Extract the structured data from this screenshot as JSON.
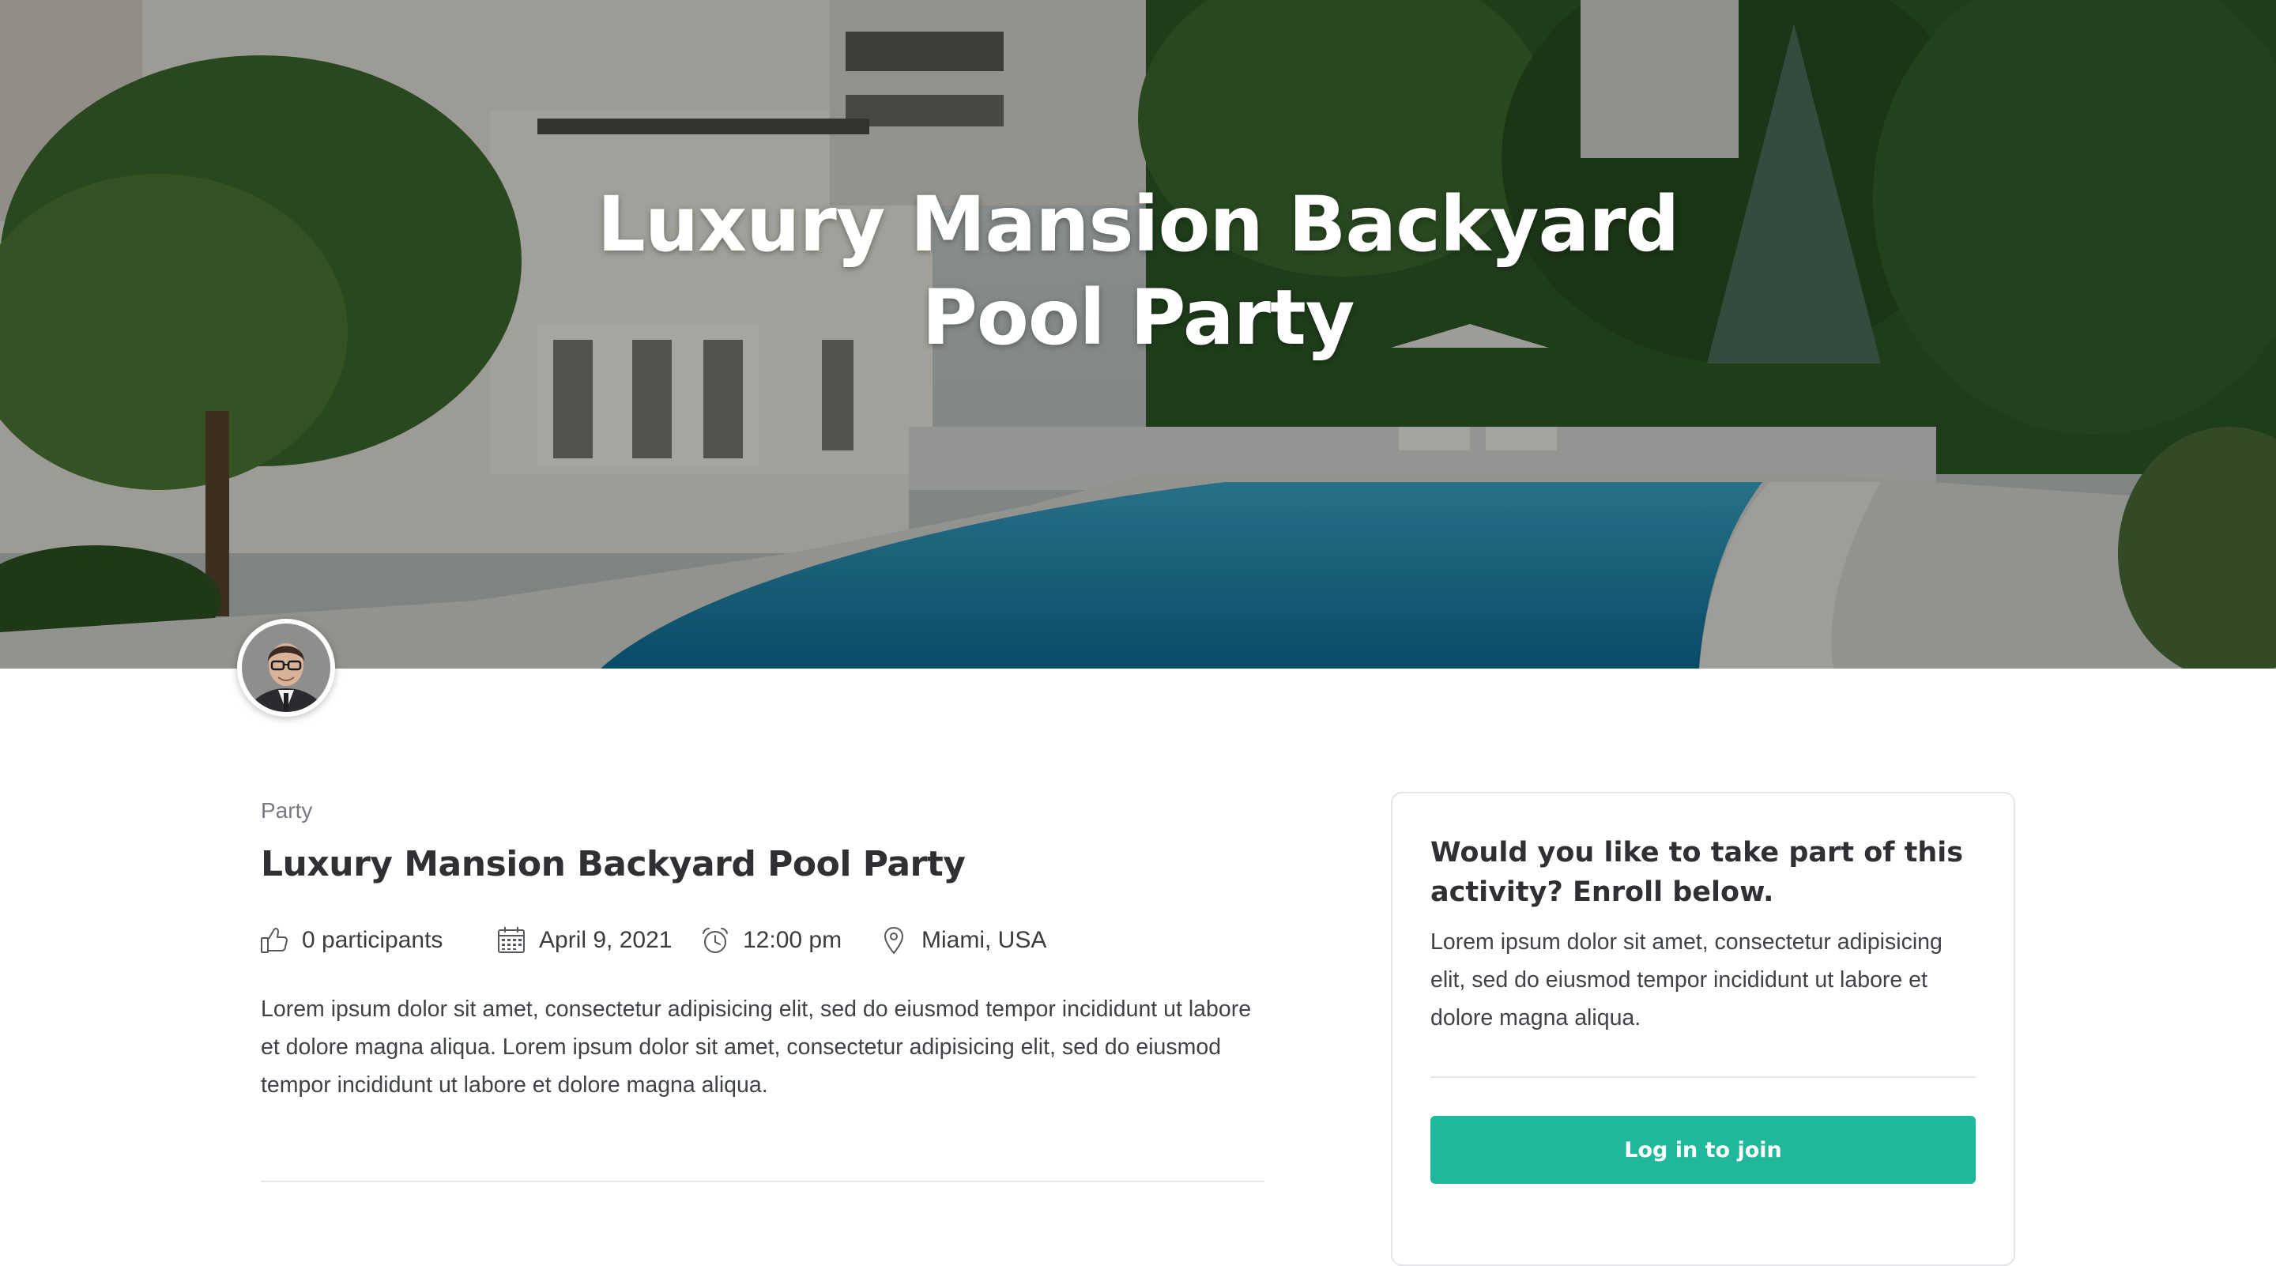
{
  "hero": {
    "title": "Luxury Mansion Backyard Pool Party"
  },
  "event": {
    "category": "Party",
    "title": "Luxury Mansion Backyard Pool Party",
    "meta": {
      "participants": "0 participants",
      "date": "April 9, 2021",
      "time": "12:00 pm",
      "location": "Miami, USA"
    },
    "description": "Lorem ipsum dolor sit amet, consectetur adipisicing elit, sed do eiusmod tempor incididunt ut labore et dolore magna aliqua. Lorem ipsum dolor sit amet, consectetur adipisicing elit, sed do eiusmod tempor incididunt ut labore et dolore magna aliqua."
  },
  "enroll": {
    "title": "Would you like to take part of this activity? Enroll below.",
    "text": "Lorem ipsum dolor sit amet, consectetur adipisicing elit, sed do eiusmod tempor incididunt ut labore et dolore magna aliqua.",
    "button_label": "Log in to join"
  },
  "icons": {
    "participants": "thumbs-up-icon",
    "date": "calendar-icon",
    "time": "alarm-clock-icon",
    "location": "map-pin-icon"
  },
  "colors": {
    "accent": "#1fb89a",
    "text_dark": "#2e3033",
    "text_muted": "#777a80",
    "hero_overlay": "#000000"
  }
}
